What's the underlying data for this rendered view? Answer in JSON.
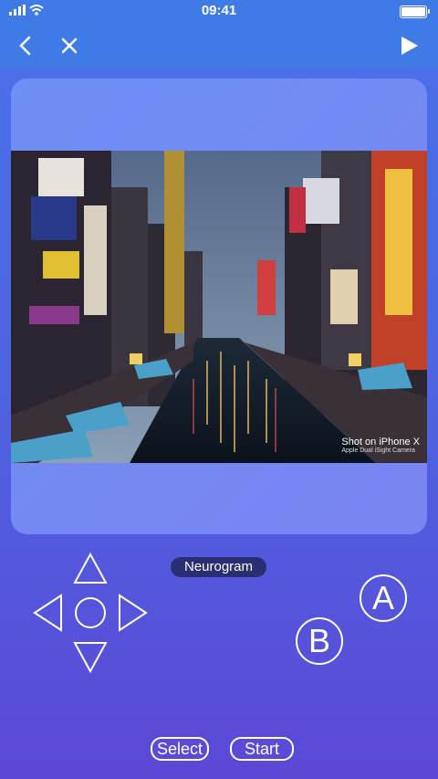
{
  "status_bar": {
    "time": "09:41"
  },
  "nav": {
    "back_icon": "chevron-left-icon",
    "close_icon": "close-icon",
    "play_icon": "play-icon"
  },
  "screen": {
    "photo_watermark": {
      "main": "Shot on iPhone X",
      "sub": "Apple Dual iSight Camera"
    }
  },
  "controller": {
    "core_label": "Neurogram",
    "buttons": {
      "a": "A",
      "b": "B",
      "select": "Select",
      "start": "Start"
    }
  },
  "colors": {
    "bar": "#3f7be6",
    "pill": "#2a2f73",
    "card": "#7a8bf5"
  }
}
